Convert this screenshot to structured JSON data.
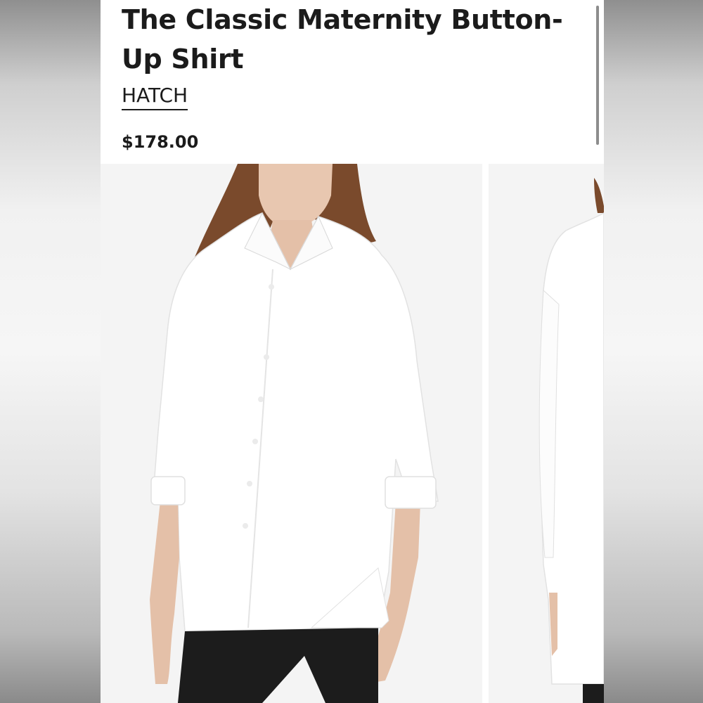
{
  "product": {
    "title": "The Classic Maternity Button-Up Shirt",
    "brand": "HATCH",
    "price": "$178.00"
  },
  "gallery": {
    "images": [
      {
        "name": "front-view",
        "alt": ""
      },
      {
        "name": "side-back-view",
        "alt": ""
      }
    ]
  },
  "colors": {
    "text": "#1b1b1b",
    "page": "#ffffff",
    "photo_background": "#f4f4f4",
    "shirt": "#ffffff",
    "hair": "#7a4a2c",
    "pants": "#1c1c1c"
  }
}
